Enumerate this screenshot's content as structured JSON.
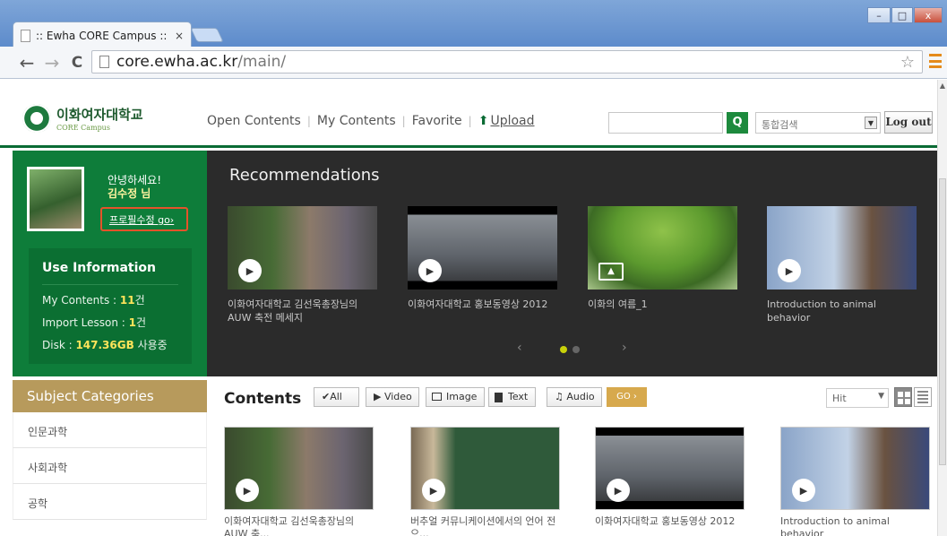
{
  "browser": {
    "tab_title": ":: Ewha CORE Campus :: ",
    "tab_close": "×",
    "url_host": "core.ewha.ac.kr",
    "url_path": "/main/",
    "back": "←",
    "forward": "→",
    "reload": "C",
    "star": "☆",
    "minimize": "–",
    "maximize": "□",
    "close": "x"
  },
  "header": {
    "logo_ko": "이화여자대학교",
    "logo_en": "CORE Campus",
    "nav": [
      "Open Contents",
      "My Contents",
      "Favorite",
      "Upload"
    ],
    "search_placeholder": "",
    "search_button": "Q",
    "scope_value": "통합검색",
    "logout": "Log out"
  },
  "profile": {
    "greeting": "안녕하세요!",
    "name": "김수정 님",
    "edit_link": "프로필수정 go›"
  },
  "use_info": {
    "title": "Use Information",
    "my_contents_label": "My Contents : ",
    "my_contents_value": "11",
    "my_contents_unit": "건",
    "import_label": "Import Lesson : ",
    "import_value": "1",
    "import_unit": "건",
    "disk_label": "Disk : ",
    "disk_value": "147.36GB",
    "disk_unit": " 사용중"
  },
  "recommendations": {
    "title": "Recommendations",
    "items": [
      {
        "caption": "이화여자대학교 김선욱총장님의 AUW 축전 메세지",
        "kind": "video"
      },
      {
        "caption": "이화여자대학교 홍보동영상 2012",
        "kind": "video"
      },
      {
        "caption": "이화의 여름_1",
        "kind": "image"
      },
      {
        "caption": "Introduction to animal behavior",
        "kind": "video"
      }
    ],
    "prev": "‹",
    "next": "›"
  },
  "subjects": {
    "title": "Subject Categories",
    "items": [
      "인문과학",
      "사회과학",
      "공학"
    ]
  },
  "contents": {
    "title": "Contents",
    "filters": [
      "✔All",
      "▶ Video",
      "Image",
      "Text",
      "♫ Audio"
    ],
    "go": "GO ›",
    "sort": "Hit",
    "items": [
      {
        "caption": "이화여자대학교 김선욱총장님의 AUW 축..."
      },
      {
        "caption": "버추얼 커뮤니케이션에서의 언어 전 으..."
      },
      {
        "caption": "이화여자대학교 홍보동영상 2012"
      },
      {
        "caption": "Introduction to animal behavior"
      }
    ]
  },
  "colors": {
    "accent_green": "#0e7d3a",
    "dark_panel": "#2b2b2b",
    "category_gold": "#b79a5c"
  }
}
